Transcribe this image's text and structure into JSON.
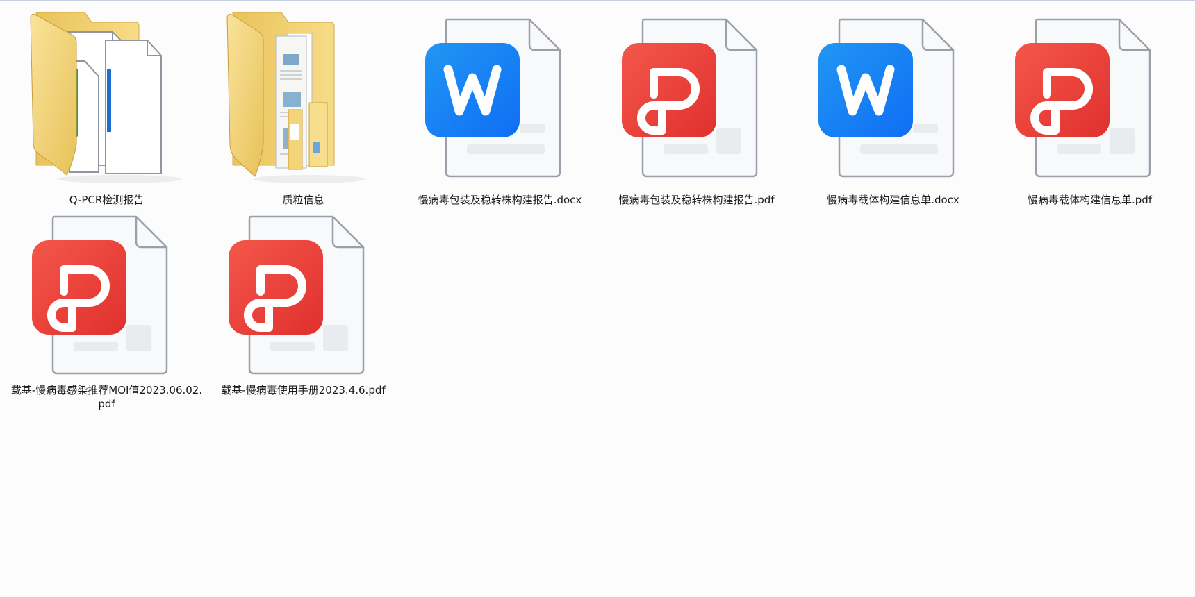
{
  "window": {
    "view_mode": "large-icons"
  },
  "files": [
    {
      "name": "Q-PCR检测报告",
      "type": "folder",
      "variant": "documents"
    },
    {
      "name": "质粒信息",
      "type": "folder",
      "variant": "pages"
    },
    {
      "name": "慢病毒包装及稳转株构建报告.docx",
      "type": "docx"
    },
    {
      "name": "慢病毒包装及稳转株构建报告.pdf",
      "type": "pdf"
    },
    {
      "name": "慢病毒载体构建信息单.docx",
      "type": "docx"
    },
    {
      "name": "慢病毒载体构建信息单.pdf",
      "type": "pdf"
    },
    {
      "name": "载基-慢病毒感染推荐MOI值2023.06.02.pdf",
      "type": "pdf"
    },
    {
      "name": "载基-慢病毒使用手册2023.4.6.pdf",
      "type": "pdf"
    }
  ],
  "colors": {
    "background": "#fcfcfc",
    "folder_yellow": "#f5d77a",
    "word_blue": "#1677ff",
    "pdf_red": "#e8443a",
    "doc_outline": "#9aa0a8"
  }
}
